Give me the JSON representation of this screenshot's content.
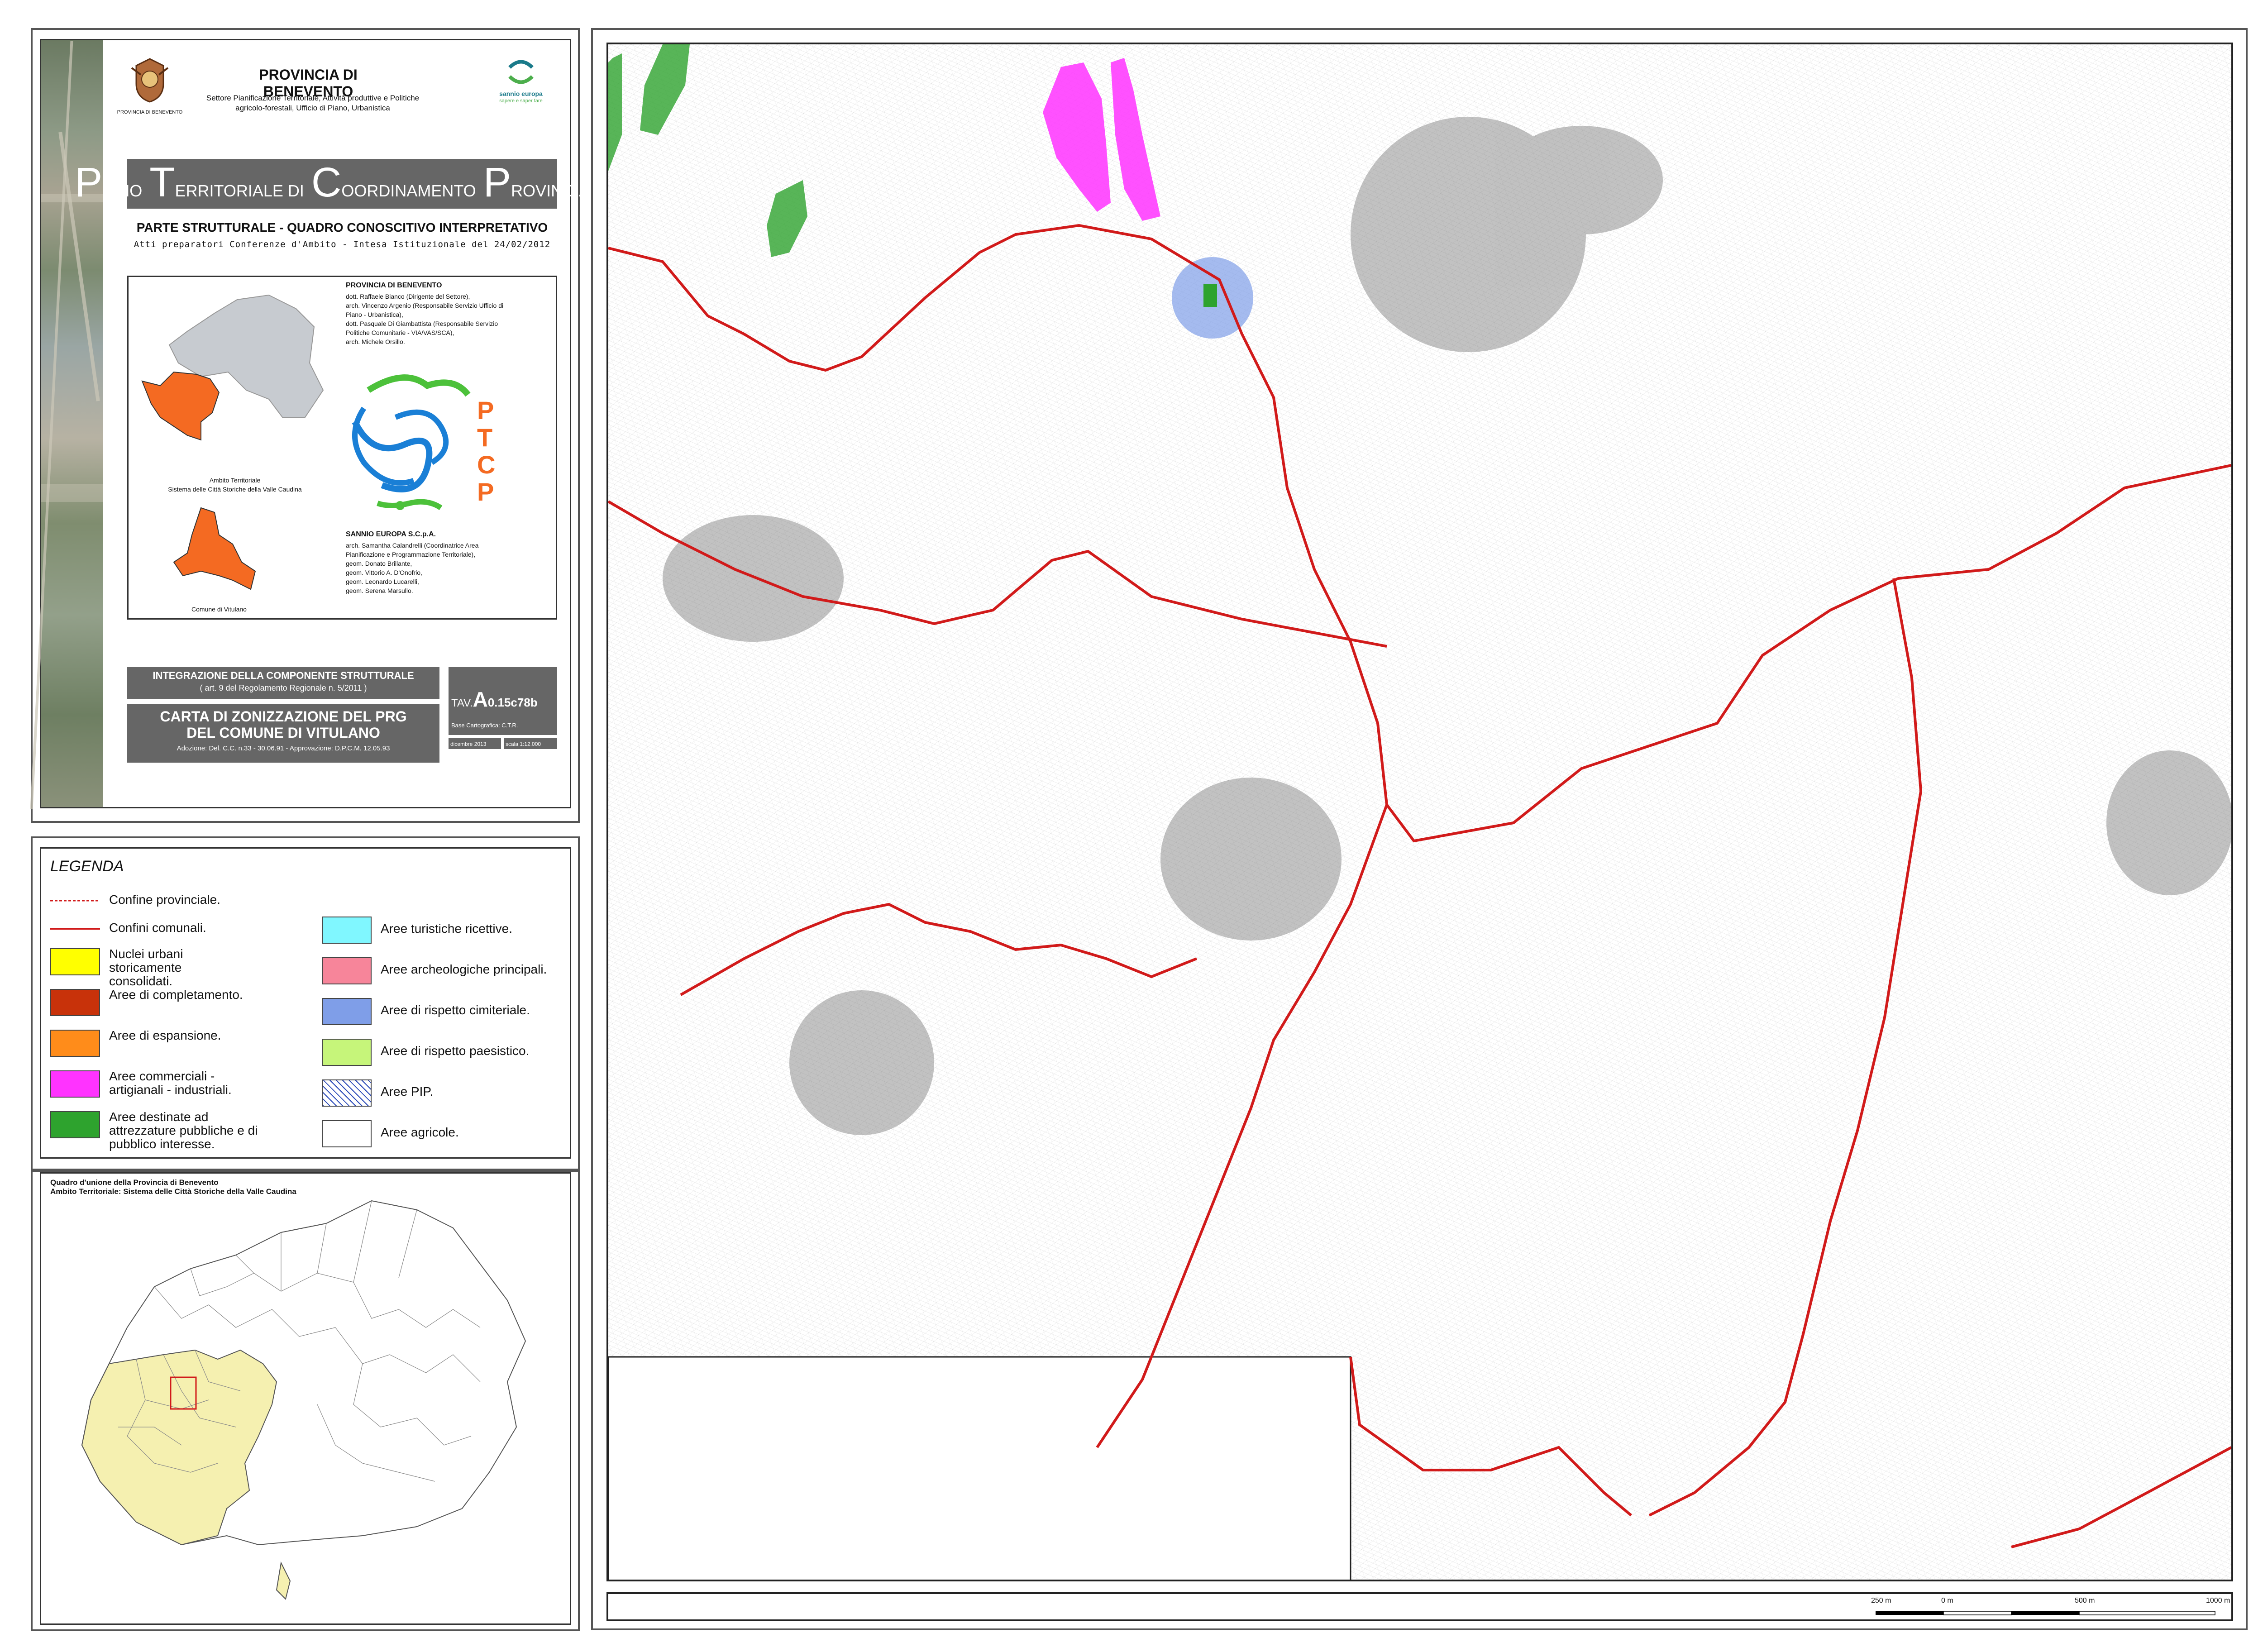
{
  "header": {
    "province": "PROVINCIA DI BENEVENTO",
    "sector_line1": "Settore Pianificazione Territoriale, Attività produttive e Politiche",
    "sector_line2": "agricolo-forestali, Ufficio di Piano, Urbanistica",
    "crest_caption": "PROVINCIA DI BENEVENTO",
    "partner_logo": "sannio europa",
    "partner_tagline": "sapere e saper fare"
  },
  "plan_title": {
    "word1_initial": "P",
    "word1_rest": "IANO",
    "word2_initial": "T",
    "word2_rest": "ERRITORIALE DI",
    "word3_initial": "C",
    "word3_rest": "OORDINAMENTO",
    "word4_initial": "P",
    "word4_rest": "ROVINCIALE"
  },
  "section_title": "PARTE STRUTTURALE - QUADRO CONOSCITIVO INTERPRETATIVO",
  "subtitle": "Atti preparatori Conferenze d'Ambito - Intesa Istituzionale del 24/02/2012",
  "credits": {
    "org1": "PROVINCIA DI BENEVENTO",
    "org1_lines": [
      "dott. Raffaele Bianco (Dirigente del Settore),",
      "arch. Vincenzo Argenio (Responsabile Servizio Ufficio di",
      "Piano - Urbanistica),",
      "dott. Pasquale Di Giambattista (Responsabile Servizio",
      "Politiche Comunitarie - VIA/VAS/SCA),",
      "arch. Michele Orsillo."
    ],
    "org2": "SANNIO EUROPA S.C.p.A.",
    "org2_lines": [
      "arch. Samantha Calandrelli (Coordinatrice Area",
      "Pianificazione e Programmazione Territoriale),",
      "geom. Donato Brillante,",
      "geom. Vittorio A. D'Onofrio,",
      "geom. Leonardo Lucarelli,",
      "geom. Serena Marsullo."
    ],
    "ambito_caption1": "Ambito Territoriale",
    "ambito_caption2": "Sistema delle Città Storiche della Valle Caudina",
    "comune_caption": "Comune di Vitulano",
    "ptcp_letters": [
      "P",
      "T",
      "C",
      "P"
    ]
  },
  "integration": {
    "line1": "INTEGRAZIONE DELLA COMPONENTE STRUTTURALE",
    "line2": "( art. 9 del Regolamento Regionale n. 5/2011 )"
  },
  "map_title": {
    "line1": "CARTA DI ZONIZZAZIONE DEL PRG",
    "line2": "DEL COMUNE DI VITULANO",
    "adoption": "Adozione: Del. C.C. n.33 - 30.06.91 - Approvazione: D.P.C.M. 12.05.93"
  },
  "tav": {
    "prefix": "TAV.",
    "code_big": "A",
    "code_rest": "0.15c78b",
    "base": "Base Cartografica: C.T.R.",
    "date": "dicembre 2013",
    "scale": "scala 1:12.000"
  },
  "legend": {
    "title": "LEGENDA",
    "colors": {
      "nuclei": "#ffff00",
      "completamento": "#c8320a",
      "espansione": "#ff8c1a",
      "commerciali": "#ff33ff",
      "attrezzature": "#2ea32e",
      "turistiche": "#80f7ff",
      "archeologiche": "#f7859a",
      "cimiteriale": "#7f9ee8",
      "paesistico": "#c6f57a",
      "pip": "#2a49b8",
      "agricole": "#ffffff",
      "boundary": "#d11a1a"
    },
    "items_left": [
      {
        "label": "Confine provinciale."
      },
      {
        "label": "Confini comunali."
      },
      {
        "label": "Nuclei urbani storicamente consolidati."
      },
      {
        "label": "Aree di completamento."
      },
      {
        "label": "Aree di espansione."
      },
      {
        "label": "Aree commerciali - artigianali - industriali."
      },
      {
        "label": "Aree destinate ad attrezzature pubbliche e di pubblico interesse."
      }
    ],
    "items_right": [
      {
        "label": "Aree turistiche ricettive."
      },
      {
        "label": "Aree archeologiche principali."
      },
      {
        "label": "Aree di rispetto cimiteriale."
      },
      {
        "label": "Aree di rispetto paesistico."
      },
      {
        "label": "Aree PIP."
      },
      {
        "label": "Aree agricole."
      }
    ]
  },
  "inset": {
    "title1": "Quadro d'unione della Provincia di Benevento",
    "title2": "Ambito Territoriale: Sistema delle Città Storiche della Valle Caudina",
    "highlight_color": "#f5f0b0"
  },
  "scale_bar": {
    "labels": [
      "250 m",
      "0 m",
      "500 m",
      "1000 m"
    ]
  }
}
